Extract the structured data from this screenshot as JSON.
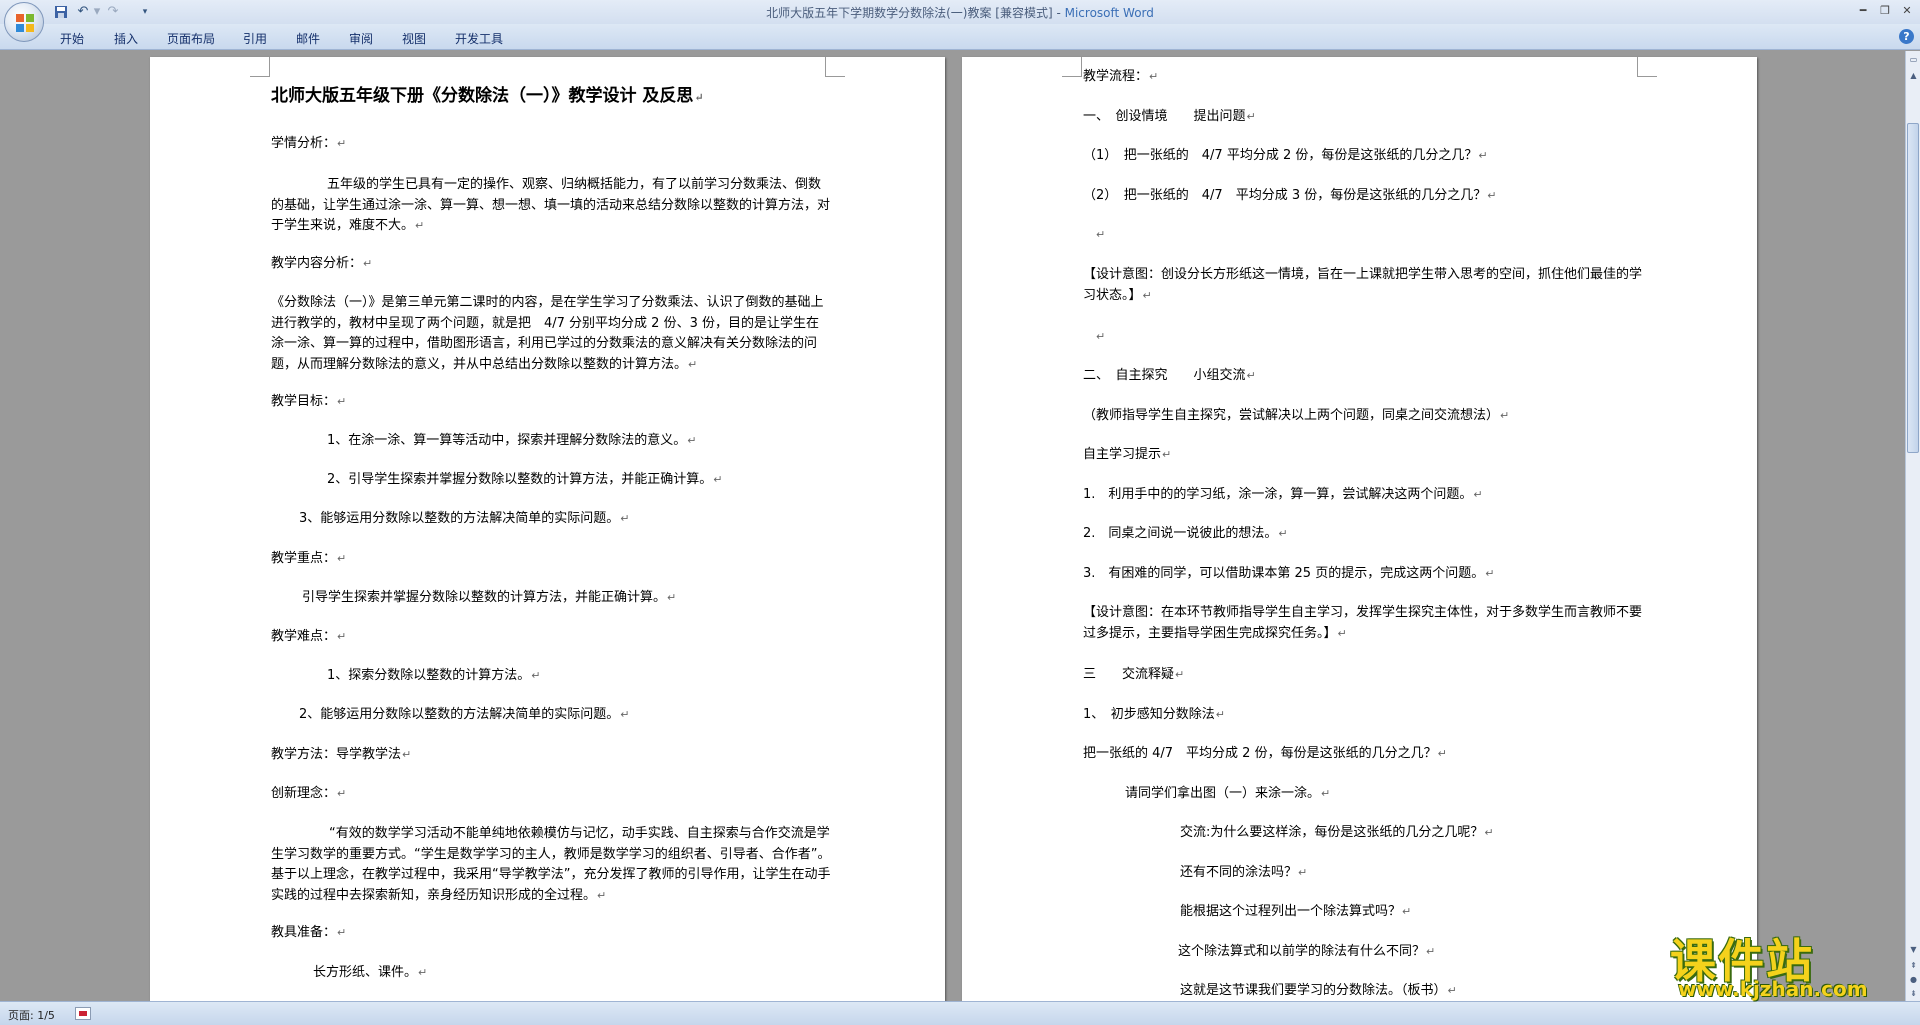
{
  "titlebar": {
    "doc_name": "北师大版五年下学期数学分数除法(一)教案 [兼容模式] - ",
    "app_name": "Microsoft Word",
    "qat": {
      "save_icon": "save-icon",
      "undo_icon": "undo-icon",
      "redo_icon": "redo-icon",
      "customize_icon": "dropdown-icon"
    }
  },
  "ribbon": {
    "tabs": [
      "开始",
      "插入",
      "页面布局",
      "引用",
      "邮件",
      "审阅",
      "视图",
      "开发工具"
    ],
    "help": "?"
  },
  "page1": {
    "title": "北师大版五年级下册《分数除法（一）》教学设计 及反思",
    "paragraphs": [
      "学情分析：",
      "五年级的学生已具有一定的操作、观察、归纳概括能力，有了以前学习分数乘法、倒数的基础，让学生通过涂一涂、算一算、想一想、填一填的活动来总结分数除以整数的计算方法，对于学生来说，难度不大。",
      "教学内容分析：",
      "《分数除法（一）》是第三单元第二课时的内容，是在学生学习了分数乘法、认识了倒数的基础上进行教学的，教材中呈现了两个问题，就是把　4/7 分别平均分成 2 份、3 份，目的是让学生在涂一涂、算一算的过程中，借助图形语言，利用已学过的分数乘法的意义解决有关分数除法的问题，从而理解分数除法的意义，并从中总结出分数除以整数的计算方法。",
      "教学目标：",
      "1、在涂一涂、算一算等活动中，探索并理解分数除法的意义。",
      "2、引导学生探索并掌握分数除以整数的计算方法，并能正确计算。",
      "3、能够运用分数除以整数的方法解决简单的实际问题。",
      "教学重点：",
      "引导学生探索并掌握分数除以整数的计算方法，并能正确计算。",
      "教学难点：",
      "1、探索分数除以整数的计算方法。",
      "2、能够运用分数除以整数的方法解决简单的实际问题。",
      "教学方法：导学教学法",
      "创新理念：",
      "“有效的数学学习活动不能单纯地依赖模仿与记忆，动手实践、自主探索与合作交流是学生学习数学的重要方式。“学生是数学学习的主人，教师是数学学习的组织者、引导者、合作者”。基于以上理念，在教学过程中，我采用“导学教学法”，充分发挥了教师的引导作用，让学生在动手实践的过程中去探索新知，亲身经历知识形成的全过程。",
      "教具准备：",
      "长方形纸、课件。"
    ]
  },
  "page2": {
    "paragraphs": [
      "教学流程：",
      "一、　创设情境　　提出问题",
      "（1）　把一张纸的　4/7 平均分成 2 份，每份是这张纸的几分之几？",
      "（2）　把一张纸的　4/7　平均分成 3 份，每份是这张纸的几分之几？",
      "",
      "【设计意图：创设分长方形纸这一情境，旨在一上课就把学生带入思考的空间，抓住他们最佳的学习状态。】",
      "",
      "二、　自主探究　　小组交流",
      "（教师指导学生自主探究，尝试解决以上两个问题，同桌之间交流想法）",
      "自主学习提示",
      "1.　利用手中的的学习纸，涂一涂，算一算，尝试解决这两个问题。",
      "2.　同桌之间说一说彼此的想法。",
      "3.　有困难的同学，可以借助课本第 25 页的提示，完成这两个问题。",
      "【设计意图：在本环节教师指导学生自主学习，发挥学生探究主体性，对于多数学生而言教师不要过多提示，主要指导学困生完成探究任务。】",
      "三　　交流释疑",
      "1、　初步感知分数除法",
      "把一张纸的 4/7　平均分成 2 份，每份是这张纸的几分之几？",
      "请同学们拿出图（一）来涂一涂。",
      "交流:为什么要这样涂，每份是这张纸的几分之几呢？",
      "还有不同的涂法吗？",
      "能根据这个过程列出一个除法算式吗？",
      "这个除法算式和以前学的除法有什么不同？",
      "这就是这节课我们要学习的分数除法。（板书）"
    ]
  },
  "statusbar": {
    "page": "页面: 1/5"
  },
  "watermark": {
    "title": "课件站",
    "url": "www.kjzhan.com"
  },
  "colors": {
    "workspace": "#9a9a9a",
    "ribbon": "#c9d9ee",
    "title_app": "#3b6fb6",
    "watermark": "#f4d21c"
  }
}
